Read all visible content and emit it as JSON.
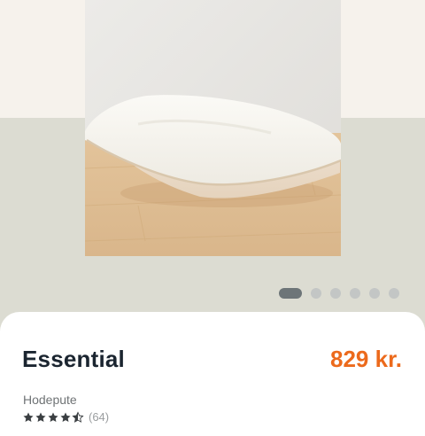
{
  "product": {
    "name": "Essential",
    "price": "829 kr.",
    "category": "Hodepute",
    "rating": 4.5,
    "rating_max": 5,
    "review_count": "(64)"
  },
  "carousel": {
    "total_slides": 6,
    "active_index": 0
  },
  "colors": {
    "price": "#ec6a1c",
    "title": "#1b2530",
    "star": "#3b3f42",
    "dot_active": "#6d7578",
    "dot_inactive": "#c3c6c5"
  },
  "icons": {
    "star_full": "star-icon",
    "star_half": "star-half-icon"
  }
}
